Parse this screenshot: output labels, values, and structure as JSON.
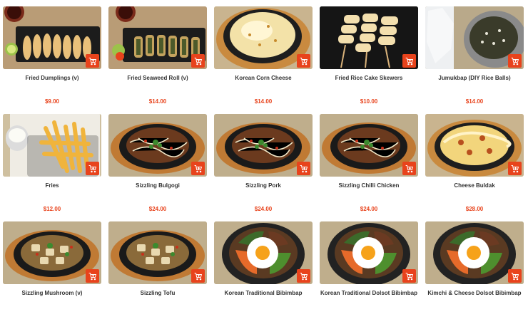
{
  "items": [
    {
      "name": "Fried Dumplings (v)",
      "price": "$9.00",
      "photo": "dumplings"
    },
    {
      "name": "Fried Seaweed Roll (v)",
      "price": "$14.00",
      "photo": "seaweed-roll"
    },
    {
      "name": "Korean Corn Cheese",
      "price": "$14.00",
      "photo": "corn-cheese"
    },
    {
      "name": "Fried Rice Cake Skewers",
      "price": "$10.00",
      "photo": "rice-cake-skewers"
    },
    {
      "name": "Jumukbap (DIY Rice Balls)",
      "price": "$14.00",
      "photo": "rice-balls"
    },
    {
      "name": "Fries",
      "price": "$12.00",
      "photo": "fries"
    },
    {
      "name": "Sizzling Bulgogi",
      "price": "$24.00",
      "photo": "sizzling-plate"
    },
    {
      "name": "Sizzling Pork",
      "price": "$24.00",
      "photo": "sizzling-plate"
    },
    {
      "name": "Sizzling Chilli Chicken",
      "price": "$24.00",
      "photo": "sizzling-plate"
    },
    {
      "name": "Cheese Buldak",
      "price": "$28.00",
      "photo": "cheese-buldak"
    },
    {
      "name": "Sizzling Mushroom (v)",
      "price": "",
      "photo": "sizzling-veg"
    },
    {
      "name": "Sizzling Tofu",
      "price": "",
      "photo": "sizzling-veg"
    },
    {
      "name": "Korean Traditional Bibimbap",
      "price": "",
      "photo": "bibimbap"
    },
    {
      "name": "Korean Traditional Dolsot Bibimbap",
      "price": "",
      "photo": "bibimbap"
    },
    {
      "name": "Kimchi & Cheese Dolsot Bibimbap",
      "price": "",
      "photo": "bibimbap"
    }
  ],
  "cart_icon": "add-to-cart-icon",
  "colors": {
    "accent": "#e8431c",
    "name_text": "#333333"
  }
}
